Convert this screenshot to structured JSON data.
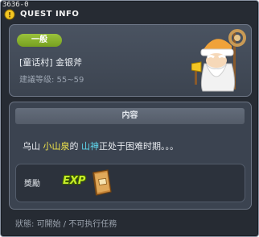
{
  "window": {
    "id": "3636-0",
    "title": "QUEST INFO"
  },
  "quest": {
    "type_badge": "一般",
    "name": "[童话村] 金银斧",
    "level_range": "建議等级: 55~59"
  },
  "content": {
    "header": "内容",
    "text_parts": [
      "乌山 ",
      "小山泉",
      "的 ",
      "山神",
      "正处于困难时期。。。"
    ]
  },
  "reward": {
    "label": "獎勵",
    "exp_label": "EXP",
    "item_icon": "book-icon"
  },
  "status_line": "狀態: 可開始 / 不可执行任務",
  "colors": {
    "badge_green": "#88b22c",
    "highlight_yellow": "#f6e94a",
    "highlight_cyan": "#5fd8ee",
    "panel_bg": "#3b4350",
    "window_bg": "#262b33"
  }
}
